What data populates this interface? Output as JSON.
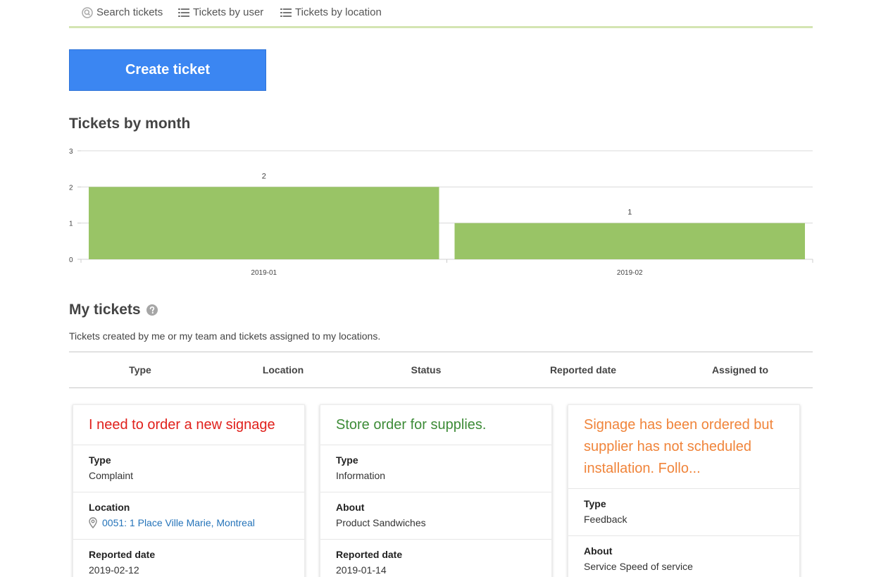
{
  "nav": {
    "search": "Search tickets",
    "by_user": "Tickets by user",
    "by_location": "Tickets by location"
  },
  "create_button": "Create ticket",
  "chart_section_title": "Tickets by month",
  "chart_data": {
    "type": "bar",
    "title": "Tickets by month",
    "categories": [
      "2019-01",
      "2019-02"
    ],
    "values": [
      2,
      1
    ],
    "data_labels": [
      "2",
      "1"
    ],
    "ylim": [
      0,
      3
    ],
    "yticks": [
      "0",
      "1",
      "2",
      "3"
    ],
    "grid": true,
    "color": "#99c466"
  },
  "tickets_title": "My tickets",
  "tickets_desc": "Tickets created by me or my team and tickets assigned to my locations.",
  "columns": [
    "Type",
    "Location",
    "Status",
    "Reported date",
    "Assigned to"
  ],
  "cards": [
    {
      "title": "I need to order a new signage",
      "title_color": "#e0201b",
      "fields": [
        {
          "label": "Type",
          "value": "Complaint"
        },
        {
          "label": "Location",
          "value": "0051: 1 Place Ville Marie, Montreal",
          "is_location": true
        },
        {
          "label": "Reported date",
          "value": "2019-02-12"
        }
      ]
    },
    {
      "title": "Store order for supplies.",
      "title_color": "#3d8b37",
      "fields": [
        {
          "label": "Type",
          "value": "Information"
        },
        {
          "label": "About",
          "value": "Product Sandwiches"
        },
        {
          "label": "Reported date",
          "value": "2019-01-14"
        }
      ]
    },
    {
      "title": "Signage has been ordered but supplier has not scheduled installation. Follo...",
      "title_color": "#f0843a",
      "fields": [
        {
          "label": "Type",
          "value": "Feedback"
        },
        {
          "label": "About",
          "value": "Service Speed of service"
        }
      ]
    }
  ]
}
